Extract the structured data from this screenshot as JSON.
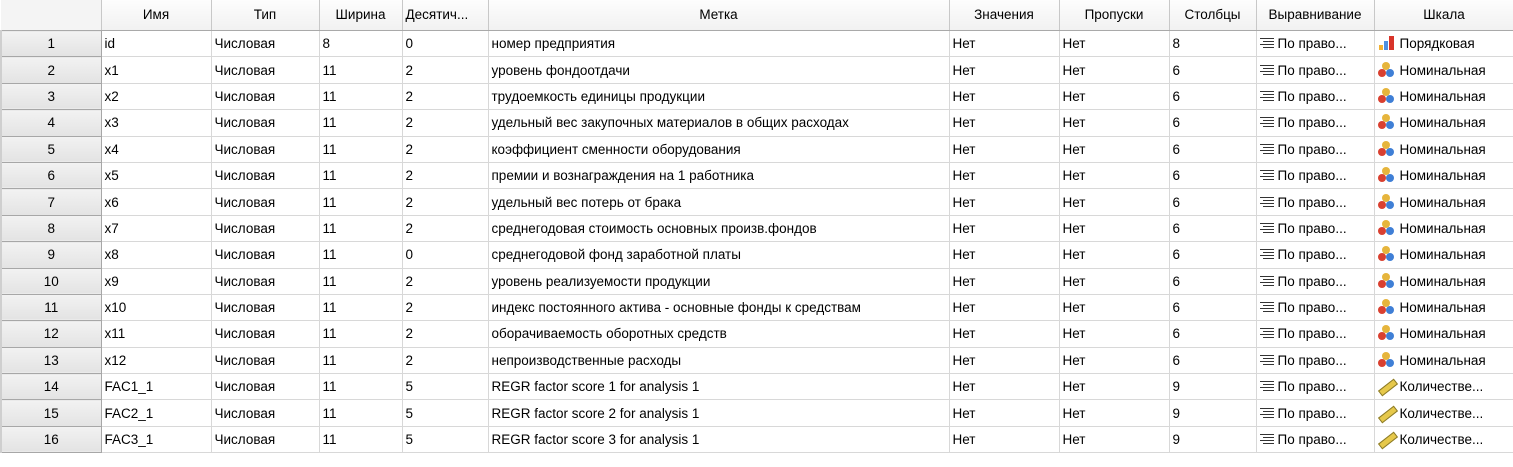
{
  "columns": [
    "Имя",
    "Тип",
    "Ширина",
    "Десятич...",
    "Метка",
    "Значения",
    "Пропуски",
    "Столбцы",
    "Выравнивание",
    "Шкала"
  ],
  "rows": [
    {
      "num": "1",
      "name": "id",
      "type": "Числовая",
      "width": "8",
      "decimals": "0",
      "label": "номер предприятия",
      "values": "Нет",
      "missing": "Нет",
      "columns": "8",
      "align": "По право...",
      "measure": "Порядковая",
      "measure_icon": "ordinal-icon"
    },
    {
      "num": "2",
      "name": "x1",
      "type": "Числовая",
      "width": "11",
      "decimals": "2",
      "label": "уровень фондоотдачи",
      "values": "Нет",
      "missing": "Нет",
      "columns": "6",
      "align": "По право...",
      "measure": "Номинальная",
      "measure_icon": "nominal-icon"
    },
    {
      "num": "3",
      "name": "x2",
      "type": "Числовая",
      "width": "11",
      "decimals": "2",
      "label": "трудоемкость единицы продукции",
      "values": "Нет",
      "missing": "Нет",
      "columns": "6",
      "align": "По право...",
      "measure": "Номинальная",
      "measure_icon": "nominal-icon"
    },
    {
      "num": "4",
      "name": "x3",
      "type": "Числовая",
      "width": "11",
      "decimals": "2",
      "label": "удельный вес закупочных материалов в общих расходах",
      "values": "Нет",
      "missing": "Нет",
      "columns": "6",
      "align": "По право...",
      "measure": "Номинальная",
      "measure_icon": "nominal-icon"
    },
    {
      "num": "5",
      "name": "x4",
      "type": "Числовая",
      "width": "11",
      "decimals": "2",
      "label": "коэффициент сменности оборудования",
      "values": "Нет",
      "missing": "Нет",
      "columns": "6",
      "align": "По право...",
      "measure": "Номинальная",
      "measure_icon": "nominal-icon"
    },
    {
      "num": "6",
      "name": "x5",
      "type": "Числовая",
      "width": "11",
      "decimals": "2",
      "label": "премии  и вознаграждения на 1 работника",
      "values": "Нет",
      "missing": "Нет",
      "columns": "6",
      "align": "По право...",
      "measure": "Номинальная",
      "measure_icon": "nominal-icon"
    },
    {
      "num": "7",
      "name": "x6",
      "type": "Числовая",
      "width": "11",
      "decimals": "2",
      "label": "удельный вес потерь от брака",
      "values": "Нет",
      "missing": "Нет",
      "columns": "6",
      "align": "По право...",
      "measure": "Номинальная",
      "measure_icon": "nominal-icon"
    },
    {
      "num": "8",
      "name": "x7",
      "type": "Числовая",
      "width": "11",
      "decimals": "2",
      "label": "среднегодовая стоимость основных произв.фондов",
      "values": "Нет",
      "missing": "Нет",
      "columns": "6",
      "align": "По право...",
      "measure": "Номинальная",
      "measure_icon": "nominal-icon"
    },
    {
      "num": "9",
      "name": "x8",
      "type": "Числовая",
      "width": "11",
      "decimals": "0",
      "label": "среднегодовой фонд заработной платы",
      "values": "Нет",
      "missing": "Нет",
      "columns": "6",
      "align": "По право...",
      "measure": "Номинальная",
      "measure_icon": "nominal-icon"
    },
    {
      "num": "10",
      "name": "x9",
      "type": "Числовая",
      "width": "11",
      "decimals": "2",
      "label": "уровень реализуемости продукции",
      "values": "Нет",
      "missing": "Нет",
      "columns": "6",
      "align": "По право...",
      "measure": "Номинальная",
      "measure_icon": "nominal-icon"
    },
    {
      "num": "11",
      "name": "x10",
      "type": "Числовая",
      "width": "11",
      "decimals": "2",
      "label": "индекс постоянного актива - основные фонды к средствам",
      "values": "Нет",
      "missing": "Нет",
      "columns": "6",
      "align": "По право...",
      "measure": "Номинальная",
      "measure_icon": "nominal-icon"
    },
    {
      "num": "12",
      "name": "x11",
      "type": "Числовая",
      "width": "11",
      "decimals": "2",
      "label": "оборачиваемость оборотных средств",
      "values": "Нет",
      "missing": "Нет",
      "columns": "6",
      "align": "По право...",
      "measure": "Номинальная",
      "measure_icon": "nominal-icon"
    },
    {
      "num": "13",
      "name": "x12",
      "type": "Числовая",
      "width": "11",
      "decimals": "2",
      "label": "непроизводственные расходы",
      "values": "Нет",
      "missing": "Нет",
      "columns": "6",
      "align": "По право...",
      "measure": "Номинальная",
      "measure_icon": "nominal-icon"
    },
    {
      "num": "14",
      "name": "FAC1_1",
      "type": "Числовая",
      "width": "11",
      "decimals": "5",
      "label": "REGR factor score   1 for analysis 1",
      "values": "Нет",
      "missing": "Нет",
      "columns": "9",
      "align": "По право...",
      "measure": "Количестве...",
      "measure_icon": "scale-ruler-icon"
    },
    {
      "num": "15",
      "name": "FAC2_1",
      "type": "Числовая",
      "width": "11",
      "decimals": "5",
      "label": "REGR factor score   2 for analysis 1",
      "values": "Нет",
      "missing": "Нет",
      "columns": "9",
      "align": "По право...",
      "measure": "Количестве...",
      "measure_icon": "scale-ruler-icon"
    },
    {
      "num": "16",
      "name": "FAC3_1",
      "type": "Числовая",
      "width": "11",
      "decimals": "5",
      "label": "REGR factor score   3 for analysis 1",
      "values": "Нет",
      "missing": "Нет",
      "columns": "9",
      "align": "По право...",
      "measure": "Количестве...",
      "measure_icon": "scale-ruler-icon"
    }
  ]
}
